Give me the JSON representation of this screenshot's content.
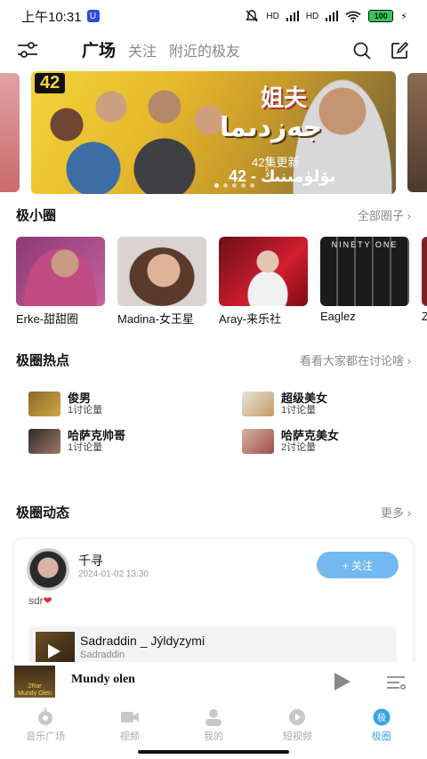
{
  "status_bar": {
    "time": "上午10:31",
    "app_badge": "U",
    "signal_1": "HD",
    "signal_2": "HD",
    "battery": "100"
  },
  "top_nav": {
    "tabs": [
      {
        "label": "广场",
        "active": true
      },
      {
        "label": "关注",
        "active": false
      },
      {
        "label": "附近的极友",
        "active": false
      }
    ],
    "icons": [
      "menu-settings-icon",
      "search-icon",
      "edit-icon"
    ]
  },
  "banner": {
    "badge": "42",
    "title_cn": "姐夫",
    "title_ug": "جەزدىما",
    "subtitle": "42集更新",
    "episode": "42 - بۆلۈمىنىڭ",
    "dots": 5,
    "active_dot": 1
  },
  "circles_section": {
    "title": "极小圈",
    "more": "全部圈子",
    "items": [
      {
        "name": "Erke-甜甜圈"
      },
      {
        "name": "Madina-女王星"
      },
      {
        "name": "Aray-来乐社"
      },
      {
        "name": "Eaglez",
        "overlay": "NINETY ONE"
      },
      {
        "name": "Zi"
      }
    ]
  },
  "hot_section": {
    "title": "极圈热点",
    "more": "看看大家都在讨论啥",
    "items": [
      {
        "title": "俊男",
        "sub": "1讨论量"
      },
      {
        "title": "超级美女",
        "sub": "1讨论量"
      },
      {
        "title": "哈萨克帅哥",
        "sub": "1讨论量"
      },
      {
        "title": "哈萨克美女",
        "sub": "2讨论量"
      }
    ]
  },
  "feed_section": {
    "title": "极圈动态",
    "more": "更多"
  },
  "post": {
    "user": "千寻",
    "time": "2024-01-02 13:30",
    "follow_label": "+ 关注",
    "content": "sdr",
    "music": {
      "title": "Sadraddin _ Jýldyzymi",
      "artist": "Sadraddin"
    }
  },
  "player": {
    "song": "Mundy olen",
    "cover_text_1": "2Rar",
    "cover_text_2": "Mundy Olen"
  },
  "tab_bar": {
    "items": [
      {
        "label": "音乐广场",
        "active": false
      },
      {
        "label": "视频",
        "active": false
      },
      {
        "label": "我的",
        "active": false
      },
      {
        "label": "短视频",
        "active": false
      },
      {
        "label": "极圈",
        "active": true,
        "icon_text": "极"
      }
    ]
  },
  "colors": {
    "accent": "#3aa3e8",
    "follow_button": "#71b9ef",
    "heart": "#e0283a"
  }
}
